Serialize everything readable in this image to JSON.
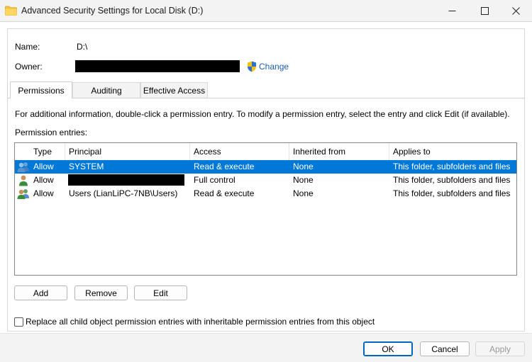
{
  "window": {
    "title": "Advanced Security Settings for Local Disk (D:)"
  },
  "info": {
    "name_label": "Name:",
    "name_value": "D:\\",
    "owner_label": "Owner:",
    "change_label": "Change"
  },
  "tabs": [
    {
      "label": "Permissions",
      "active": true
    },
    {
      "label": "Auditing",
      "active": false
    },
    {
      "label": "Effective Access",
      "active": false
    }
  ],
  "permissions": {
    "info_text": "For additional information, double-click a permission entry. To modify a permission entry, select the entry and click Edit (if available).",
    "entries_label": "Permission entries:",
    "columns": [
      "Type",
      "Principal",
      "Access",
      "Inherited from",
      "Applies to"
    ],
    "rows": [
      {
        "type": "Allow",
        "principal": "SYSTEM",
        "access": "Read & execute",
        "inherited": "None",
        "applies": "This folder, subfolders and files",
        "icon": "group-users-icon",
        "selected": true
      },
      {
        "type": "Allow",
        "principal": "",
        "access": "Full control",
        "inherited": "None",
        "applies": "This folder, subfolders and files",
        "icon": "user-icon",
        "selected": false,
        "principal_redacted": true
      },
      {
        "type": "Allow",
        "principal": "Users (LianLiPC-7NB\\Users)",
        "access": "Read & execute",
        "inherited": "None",
        "applies": "This folder, subfolders and files",
        "icon": "group-users-icon",
        "selected": false
      }
    ]
  },
  "actions": {
    "add": "Add",
    "remove": "Remove",
    "edit": "Edit"
  },
  "replace_checkbox": {
    "label": "Replace all child object permission entries with inheritable permission entries from this object",
    "checked": false
  },
  "footer": {
    "ok": "OK",
    "cancel": "Cancel",
    "apply": "Apply"
  },
  "colors": {
    "selection": "#0078d7",
    "link": "#1a5fb4",
    "accent": "#0067c0"
  }
}
